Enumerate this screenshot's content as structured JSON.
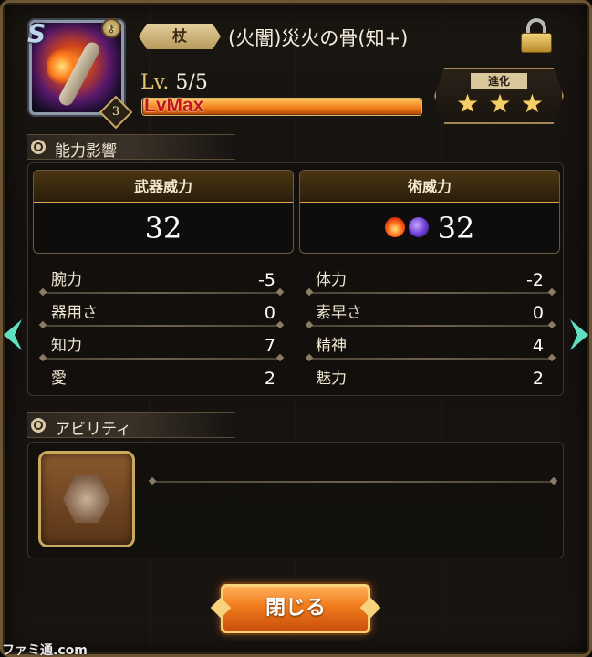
{
  "weapon": {
    "type": "杖",
    "name": "(火闇)災火の骨(知+)",
    "rank": "3",
    "level_label": "Lv.",
    "level_value": "5/5",
    "lvmax": "LvMax",
    "evolve_label": "進化",
    "stars": [
      "★",
      "★",
      "★"
    ],
    "stars_filled": 3
  },
  "sections": {
    "ability_effect": "能力影響",
    "ability": "アビリティ"
  },
  "power": {
    "weapon_power_label": "武器威力",
    "weapon_power_value": "32",
    "skill_power_label": "術威力",
    "skill_power_value": "32",
    "skill_elements": [
      "fire-icon",
      "dark-icon"
    ]
  },
  "stats": [
    {
      "name": "腕力",
      "value": "-5"
    },
    {
      "name": "体力",
      "value": "-2"
    },
    {
      "name": "器用さ",
      "value": "0"
    },
    {
      "name": "素早さ",
      "value": "0"
    },
    {
      "name": "知力",
      "value": "7"
    },
    {
      "name": "精神",
      "value": "4"
    },
    {
      "name": "愛",
      "value": "2"
    },
    {
      "name": "魅力",
      "value": "2"
    }
  ],
  "buttons": {
    "close": "閉じる"
  },
  "watermark": "ファミ通.com",
  "colors": {
    "accent": "#f07a1c",
    "gold": "#c9a860",
    "text": "#f1e7d2"
  }
}
